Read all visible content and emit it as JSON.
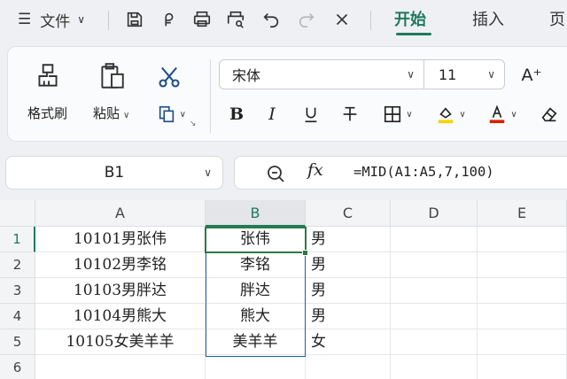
{
  "topbar": {
    "file_label": "文件",
    "tabs": [
      {
        "label": "开始",
        "active": true
      },
      {
        "label": "插入",
        "active": false
      },
      {
        "label": "页",
        "active": false
      }
    ],
    "icons": [
      "menu-icon",
      "save-icon",
      "sync-icon",
      "print-icon",
      "print-preview-icon",
      "undo-icon",
      "redo-icon",
      "close-icon"
    ]
  },
  "ribbon": {
    "format_painter_label": "格式刷",
    "paste_label": "粘贴",
    "font_name": "宋体",
    "font_size": "11",
    "font_grow": "A⁺",
    "bold": "B",
    "italic": "I",
    "fill_color": "#f7d200",
    "font_color": "#d81e06"
  },
  "formula_bar": {
    "name_box": "B1",
    "fx": "fx",
    "formula": "=MID(A1:A5,7,100)"
  },
  "grid": {
    "columns": [
      "A",
      "B",
      "C",
      "D",
      "E"
    ],
    "selected_column": "B",
    "rows": [
      "1",
      "2",
      "3",
      "4",
      "5",
      "6"
    ],
    "cells_a": [
      "10101男张伟",
      "10102男李铭",
      "10103男胖达",
      "10104男熊大",
      "10105女美羊羊"
    ],
    "cells_b": [
      "张伟",
      "李铭",
      "胖达",
      "熊大",
      "美羊羊"
    ],
    "cells_c": [
      "男",
      "男",
      "男",
      "男",
      "女"
    ],
    "accent": "#1f7a5c"
  }
}
